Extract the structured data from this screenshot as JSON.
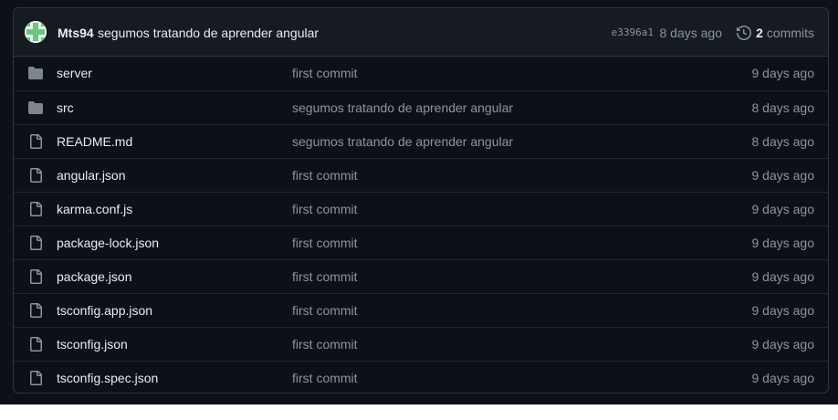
{
  "latest_commit": {
    "author": "Mts94",
    "message": "segumos tratando de aprender angular",
    "sha": "e3396a1",
    "age": "8 days ago",
    "commit_count": "2",
    "commits_label": "commits"
  },
  "files": [
    {
      "type": "folder",
      "name": "server",
      "commit_message": "first commit",
      "age": "9 days ago"
    },
    {
      "type": "folder",
      "name": "src",
      "commit_message": "segumos tratando de aprender angular",
      "age": "8 days ago"
    },
    {
      "type": "file",
      "name": "README.md",
      "commit_message": "segumos tratando de aprender angular",
      "age": "8 days ago"
    },
    {
      "type": "file",
      "name": "angular.json",
      "commit_message": "first commit",
      "age": "9 days ago"
    },
    {
      "type": "file",
      "name": "karma.conf.js",
      "commit_message": "first commit",
      "age": "9 days ago"
    },
    {
      "type": "file",
      "name": "package-lock.json",
      "commit_message": "first commit",
      "age": "9 days ago"
    },
    {
      "type": "file",
      "name": "package.json",
      "commit_message": "first commit",
      "age": "9 days ago"
    },
    {
      "type": "file",
      "name": "tsconfig.app.json",
      "commit_message": "first commit",
      "age": "9 days ago"
    },
    {
      "type": "file",
      "name": "tsconfig.json",
      "commit_message": "first commit",
      "age": "9 days ago"
    },
    {
      "type": "file",
      "name": "tsconfig.spec.json",
      "commit_message": "first commit",
      "age": "9 days ago"
    }
  ],
  "icons": {
    "avatar": "identicon-avatar",
    "history": "history-icon",
    "folder": "folder-icon",
    "file": "file-icon"
  },
  "colors": {
    "background": "#0d1117",
    "header_background": "#161b22",
    "border": "#30363d",
    "text_primary": "#e6edf3",
    "text_muted": "#8b949e",
    "folder_icon": "#7d8590",
    "avatar_green": "#6cc581"
  }
}
